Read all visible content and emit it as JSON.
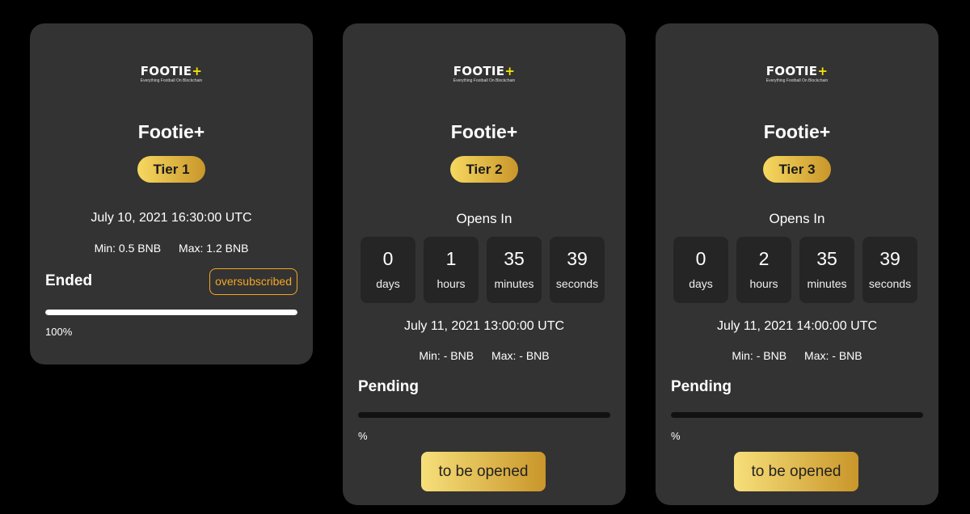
{
  "colors": {
    "page_background": "#000000",
    "card_background": "#333333",
    "countdown_box": "#252525",
    "tier_gradient": [
      "#f6d860",
      "#c9962a"
    ],
    "oversubscribed_accent": "#f5a623",
    "logo_plus": "#f6e600"
  },
  "cards": [
    {
      "logo": {
        "word": "FOOTIE",
        "plus": "+",
        "tagline": "Everything Football On Blockchain"
      },
      "name": "Footie+",
      "tier": "Tier 1",
      "datetime": "July 10, 2021 16:30:00 UTC",
      "min": "Min: 0.5 BNB",
      "max": "Max: 1.2 BNB",
      "status": "Ended",
      "badge": "oversubscribed",
      "progress": 100,
      "progress_label": "100%"
    },
    {
      "logo": {
        "word": "FOOTIE",
        "plus": "+",
        "tagline": "Everything Football On Blockchain"
      },
      "name": "Footie+",
      "tier": "Tier 2",
      "opens_label": "Opens In",
      "countdown": [
        {
          "value": "0",
          "unit": "days"
        },
        {
          "value": "1",
          "unit": "hours"
        },
        {
          "value": "35",
          "unit": "minutes"
        },
        {
          "value": "39",
          "unit": "seconds"
        }
      ],
      "datetime": "July 11, 2021 13:00:00 UTC",
      "min": "Min: - BNB",
      "max": "Max: - BNB",
      "status": "Pending",
      "progress": 0,
      "progress_label": "%",
      "button": "to be opened"
    },
    {
      "logo": {
        "word": "FOOTIE",
        "plus": "+",
        "tagline": "Everything Football On Blockchain"
      },
      "name": "Footie+",
      "tier": "Tier 3",
      "opens_label": "Opens In",
      "countdown": [
        {
          "value": "0",
          "unit": "days"
        },
        {
          "value": "2",
          "unit": "hours"
        },
        {
          "value": "35",
          "unit": "minutes"
        },
        {
          "value": "39",
          "unit": "seconds"
        }
      ],
      "datetime": "July 11, 2021 14:00:00 UTC",
      "min": "Min: - BNB",
      "max": "Max: - BNB",
      "status": "Pending",
      "progress": 0,
      "progress_label": "%",
      "button": "to be opened"
    }
  ]
}
